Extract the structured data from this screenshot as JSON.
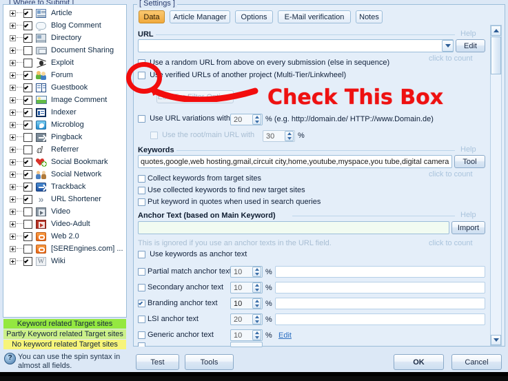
{
  "left_panel": {
    "title": "[ Where to Submit ]",
    "items": [
      {
        "label": "Article",
        "checked": true,
        "icon": "article-icon",
        "color": "#5a7fb0"
      },
      {
        "label": "Blog Comment",
        "checked": true,
        "icon": "speech-bubble-icon",
        "color": "#cfd8df"
      },
      {
        "label": "Directory",
        "checked": true,
        "icon": "directory-icon",
        "color": "#8a9aa8"
      },
      {
        "label": "Document Sharing",
        "checked": false,
        "icon": "folder-icon",
        "color": "#b9c4cc"
      },
      {
        "label": "Exploit",
        "checked": false,
        "icon": "exploit-icon",
        "color": "#3a3a3a"
      },
      {
        "label": "Forum",
        "checked": true,
        "icon": "forum-people-icon",
        "color": "#7cc04a"
      },
      {
        "label": "Guestbook",
        "checked": true,
        "icon": "guestbook-icon",
        "color": "#2f5fa8"
      },
      {
        "label": "Image Comment",
        "checked": true,
        "icon": "image-icon",
        "color": "#7ac85a"
      },
      {
        "label": "Indexer",
        "checked": true,
        "icon": "indexer-icon",
        "color": "#1b3d6b"
      },
      {
        "label": "Microblog",
        "checked": true,
        "icon": "twitter-bird-icon",
        "color": "#3ca9e0"
      },
      {
        "label": "Pingback",
        "checked": false,
        "icon": "pingback-icon",
        "color": "#6e7c88"
      },
      {
        "label": "Referrer",
        "checked": false,
        "icon": "referrer-icon",
        "color": "#3a3a3a"
      },
      {
        "label": "Social Bookmark",
        "checked": true,
        "icon": "heart-icon",
        "color": "#d83a3a"
      },
      {
        "label": "Social Network",
        "checked": true,
        "icon": "social-network-icon",
        "color": "#b07a3a"
      },
      {
        "label": "Trackback",
        "checked": true,
        "icon": "trackback-icon",
        "color": "#2558a8"
      },
      {
        "label": "URL Shortener",
        "checked": true,
        "icon": "chevrons-right-icon",
        "color": "#9aa8b5"
      },
      {
        "label": "Video",
        "checked": false,
        "icon": "film-icon",
        "color": "#97a4ae"
      },
      {
        "label": "Video-Adult",
        "checked": false,
        "icon": "film-red-icon",
        "color": "#c4352a"
      },
      {
        "label": "Web 2.0",
        "checked": true,
        "icon": "blogger-icon",
        "color": "#ef7c20"
      },
      {
        "label": "[SEREngines.com] ...",
        "checked": false,
        "icon": "blogger-icon",
        "color": "#ef7c20"
      },
      {
        "label": "Wiki",
        "checked": true,
        "icon": "wiki-w-icon",
        "color": "#7b8794"
      }
    ],
    "legend": [
      {
        "text": "Keyword related Target sites",
        "color": "#94e840"
      },
      {
        "text": "Partly Keyword related Target sites",
        "color": "#ccf08a"
      },
      {
        "text": "No keyword related Target sites",
        "color": "#f7f47a"
      }
    ],
    "tip": "You can use the spin syntax in almost all fields.",
    "tip_icon": "question-mark-icon"
  },
  "settings": {
    "title": "[ Settings ]",
    "tabs": [
      {
        "label": "Data",
        "active": true
      },
      {
        "label": "Article Manager",
        "active": false
      },
      {
        "label": "Options",
        "active": false
      },
      {
        "label": "E-Mail verification",
        "active": false
      },
      {
        "label": "Notes",
        "active": false
      }
    ],
    "url_section": {
      "title": "URL",
      "help": "Help",
      "value": "",
      "edit_button": "Edit",
      "click_to_count": "click to count",
      "random_url_checkbox": {
        "label": "Use a random URL from above on every submission (else in sequence)",
        "checked": false
      },
      "verified_url_checkbox": {
        "label": "Use verified URLs of another project (Multi-Tier/Linkwheel)",
        "checked": false
      },
      "tier_filter_button": "Edit Tier Filter Options",
      "url_variations": {
        "label": "Use URL variations with",
        "checked": false,
        "value": "20",
        "suffix": "% (e.g. http://domain.de/ HTTP://www.Domain.de)"
      },
      "root_main_url": {
        "label": "Use the root/main URL with",
        "checked": false,
        "value": "30",
        "suffix": "%"
      }
    },
    "keywords_section": {
      "title": "Keywords",
      "help": "Help",
      "value": "quotes,google,web hosting,gmail,circuit city,home,youtube,myspace,you tube,digital camera",
      "tool_button": "Tool",
      "click_to_count": "click to count",
      "checkboxes": [
        {
          "label": "Collect keywords from target sites",
          "checked": false
        },
        {
          "label": "Use collected keywords to find new target sites",
          "checked": false
        },
        {
          "label": "Put keyword in quotes when used in search queries",
          "checked": false
        }
      ]
    },
    "anchor_section": {
      "title": "Anchor Text (based on Main Keyword)",
      "help": "Help",
      "value": "",
      "import_button": "Import",
      "note": "This is ignored if you use an anchor texts in the URL field.",
      "click_to_count": "click to count",
      "use_keywords": {
        "label": "Use keywords as anchor text",
        "checked": false
      },
      "rows": [
        {
          "label": "Partial match anchor text",
          "checked": false,
          "percent": "10",
          "suffix": "%",
          "field": "",
          "dim": true
        },
        {
          "label": "Secondary anchor text",
          "checked": false,
          "percent": "10",
          "suffix": "%",
          "field": "",
          "dim": true
        },
        {
          "label": "Branding anchor text",
          "checked": true,
          "percent": "10",
          "suffix": "%",
          "field": "",
          "dim": false
        },
        {
          "label": "LSI anchor text",
          "checked": false,
          "percent": "20",
          "suffix": "%",
          "field": "",
          "dim": true
        },
        {
          "label": "Generic anchor text",
          "checked": false,
          "percent": "10",
          "suffix": "%",
          "link": "Edit",
          "dim": true
        }
      ]
    }
  },
  "footer": {
    "test_button": "Test",
    "tools_button": "Tools",
    "ok_button": "OK",
    "cancel_button": "Cancel"
  },
  "annotation": {
    "text": "Check This Box",
    "color": "#ee1111",
    "circle": "red-circle-highlight",
    "arrow": "red-arrow"
  },
  "scrollbar": {
    "up_arrow": "scroll-up-arrow",
    "down_arrow": "scroll-down-arrow",
    "thumb": "scroll-thumb"
  }
}
